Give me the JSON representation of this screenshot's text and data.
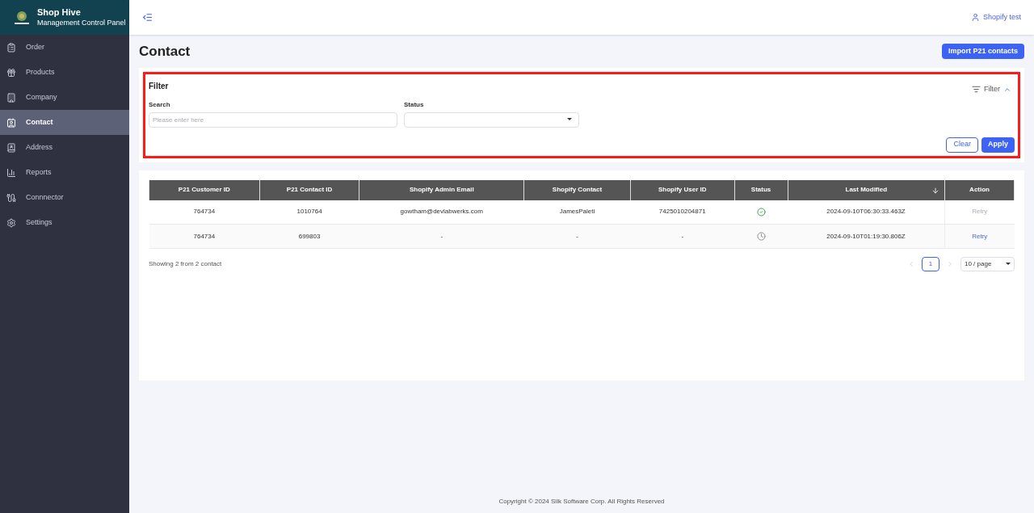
{
  "brand": {
    "title": "Shop Hive",
    "subtitle": "Management Control Panel"
  },
  "sidebar": {
    "items": [
      {
        "label": "Order",
        "selected": false
      },
      {
        "label": "Products",
        "selected": false
      },
      {
        "label": "Company",
        "selected": false
      },
      {
        "label": "Contact",
        "selected": true
      },
      {
        "label": "Address",
        "selected": false
      },
      {
        "label": "Reports",
        "selected": false
      },
      {
        "label": "Connnector",
        "selected": false
      },
      {
        "label": "Settings",
        "selected": false
      }
    ]
  },
  "user": "Shopify test",
  "page_title": "Contact",
  "import_button": "Import P21 contacts",
  "filter": {
    "title": "Filter",
    "toggle": "Filter",
    "expanded": true,
    "highlighted": true,
    "search": {
      "label": "Search",
      "placeholder": "Please enter here"
    },
    "status": {
      "label": "Status"
    },
    "clear": "Clear",
    "apply": "Apply"
  },
  "table": {
    "columns": [
      {
        "label": "P21 Customer ID",
        "sorted": false
      },
      {
        "label": "P21 Contact ID",
        "sorted": false
      },
      {
        "label": "Shopify Admin Email",
        "sorted": false
      },
      {
        "label": "Shopify Contact",
        "sorted": false
      },
      {
        "label": "Shopify User ID",
        "sorted": false
      },
      {
        "label": "Status",
        "sorted": false
      },
      {
        "label": "Last Modified",
        "sorted": true
      },
      {
        "label": "Action",
        "sorted": false
      }
    ],
    "rows": [
      {
        "cells": [
          "764734",
          "1010764",
          "gowtham@devlabwerks.com",
          "JamesPaleti",
          "7425010204871"
        ],
        "kind": "done",
        "modified": "2024-09-10T06:30:33.463Z",
        "action": "Retry",
        "action_disabled": true
      },
      {
        "cells": [
          "764734",
          "699803",
          "-",
          "-",
          "-"
        ],
        "kind": "pending",
        "modified": "2024-09-10T01:19:30.806Z",
        "action": "Retry",
        "action_disabled": false
      }
    ]
  },
  "summary": "Showing 2 from 2 contact",
  "pagination": {
    "pages": [
      {
        "label": "1",
        "selected": true
      }
    ],
    "page_size": "10 / page"
  },
  "footer": "Copyright © 2024 Silk Software Corp. All Rights Reserved"
}
